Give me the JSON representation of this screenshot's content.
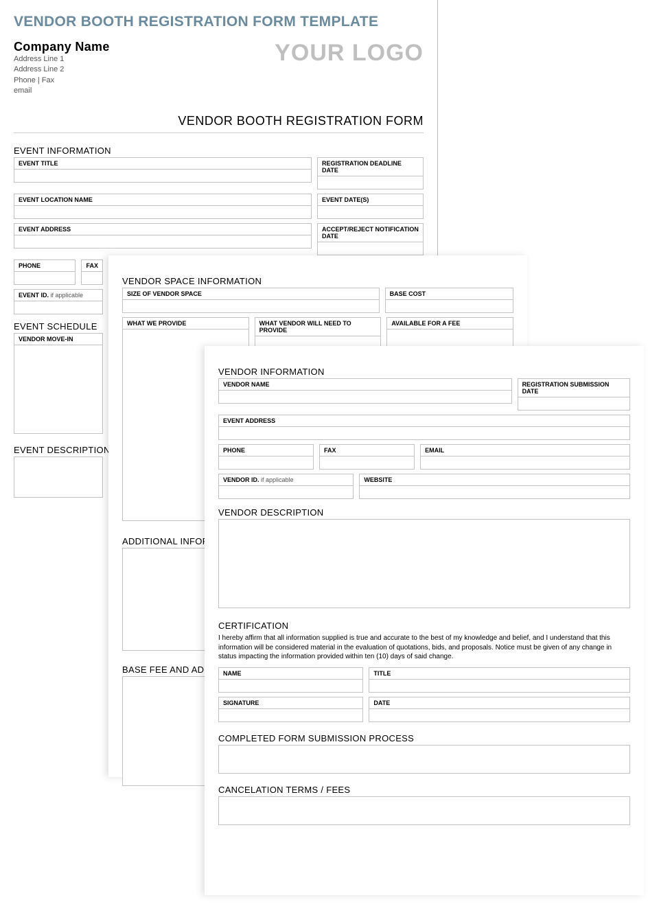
{
  "templateTitle": "VENDOR BOOTH REGISTRATION FORM TEMPLATE",
  "company": {
    "name": "Company Name",
    "addr1": "Address Line 1",
    "addr2": "Address Line 2",
    "phoneFax": "Phone | Fax",
    "email": "email"
  },
  "logoText": "YOUR LOGO",
  "formTitle": "VENDOR BOOTH REGISTRATION FORM",
  "sections": {
    "eventInfo": "EVENT INFORMATION",
    "eventTitle": "EVENT TITLE",
    "regDeadline": "REGISTRATION DEADLINE DATE",
    "eventLocName": "EVENT LOCATION NAME",
    "eventDates": "EVENT DATE(S)",
    "eventAddress": "EVENT ADDRESS",
    "acceptReject": "ACCEPT/REJECT NOTIFICATION DATE",
    "phone": "PHONE",
    "fax": "FAX",
    "eventId": "EVENT ID.",
    "ifApplicable": " if applicable",
    "eventSchedule": "EVENT SCHEDULE",
    "vendorMoveIn": "VENDOR MOVE-IN",
    "eventDescription": "EVENT DESCRIPTION",
    "vendorSpaceInfo": "VENDOR SPACE INFORMATION",
    "sizeOfSpace": "SIZE OF VENDOR SPACE",
    "baseCost": "BASE COST",
    "whatWeProvide": "WHAT WE PROVIDE",
    "whatVendorProvides": "WHAT VENDOR WILL NEED TO PROVIDE",
    "availableFee": "AVAILABLE FOR A FEE",
    "additionalInfo": "ADDITIONAL INFORMATION",
    "baseFee": "BASE FEE AND ADDITIONAL COSTS",
    "vendorInfo": "VENDOR INFORMATION",
    "vendorName": "VENDOR NAME",
    "regSubmissionDate": "REGISTRATION SUBMISSION DATE",
    "email": "EMAIL",
    "vendorId": "VENDOR ID.",
    "website": "WEBSITE",
    "vendorDescription": "VENDOR DESCRIPTION",
    "certification": "CERTIFICATION",
    "certText": "I hereby affirm that all information supplied is true and accurate to the best of my knowledge and belief, and I understand that this information will be considered material in the evaluation of quotations, bids, and proposals. Notice must be given of any change in status impacting the information provided within ten (10) days of said change.",
    "name": "NAME",
    "title": "TITLE",
    "signature": "SIGNATURE",
    "date": "DATE",
    "submissionProcess": "COMPLETED FORM SUBMISSION PROCESS",
    "cancelTerms": "CANCELATION TERMS / FEES"
  }
}
